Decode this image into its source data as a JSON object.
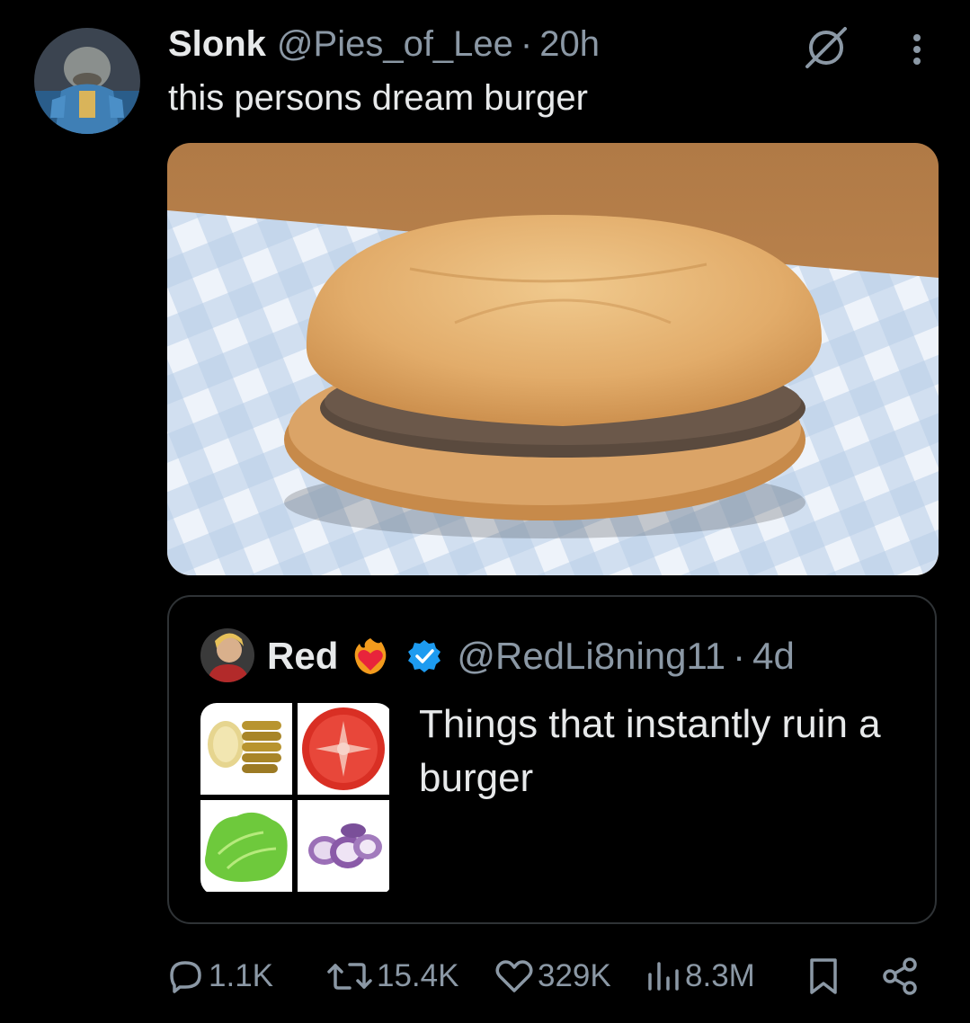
{
  "tweet": {
    "author_name": "Slonk",
    "handle": "@Pies_of_Lee",
    "separator": "·",
    "time": "20h",
    "text": "this persons dream burger",
    "image_icon": "plain-burger-photo"
  },
  "quote": {
    "author_name": "Red",
    "emoji": "heart-on-fire",
    "verified": true,
    "handle": "@RedLi8ning11",
    "separator": "·",
    "time": "4d",
    "text": "Things that instantly ruin a burger",
    "grid_icons": [
      "pickles",
      "tomato-slice",
      "lettuce",
      "red-onion-slices"
    ]
  },
  "actions": {
    "replies": "1.1K",
    "reposts": "15.4K",
    "likes": "329K",
    "views": "8.3M"
  },
  "colors": {
    "background": "#000000",
    "text_primary": "#e7e9ea",
    "text_secondary": "#8b98a5",
    "border": "#2f3336",
    "verified": "#1d9bf0"
  }
}
